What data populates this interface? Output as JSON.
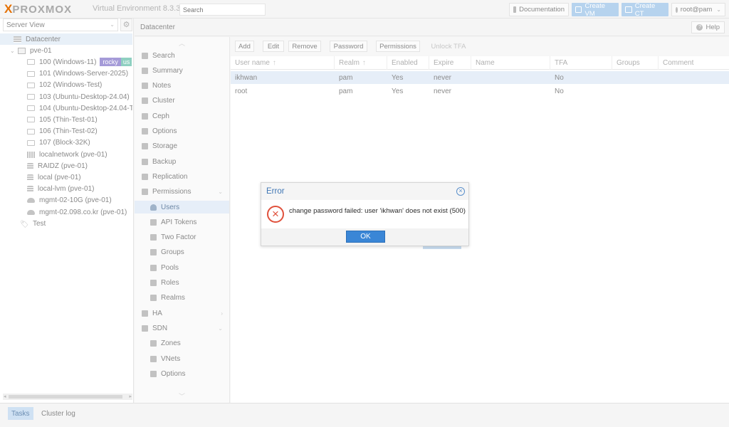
{
  "header": {
    "logo_mark": "X",
    "logo_word": "PROXMOX",
    "version": "Virtual Environment 8.3.3",
    "search_placeholder": "Search",
    "documentation": "Documentation",
    "create_vm": "Create VM",
    "create_ct": "Create CT",
    "user": "root@pam"
  },
  "tree": {
    "view": "Server View",
    "items": [
      {
        "label": "Datacenter",
        "icon": "datacenter-icon"
      },
      {
        "label": "pve-01",
        "icon": "node-icon"
      },
      {
        "label": "100 (Windows-11)",
        "icon": "vm-icon",
        "tags": [
          "rocky",
          "us"
        ]
      },
      {
        "label": "101 (Windows-Server-2025)",
        "icon": "vm-icon"
      },
      {
        "label": "102 (Windows-Test)",
        "icon": "vm-icon"
      },
      {
        "label": "103 (Ubuntu-Desktop-24.04)",
        "icon": "vm-icon"
      },
      {
        "label": "104 (Ubuntu-Desktop-24.04-TF",
        "icon": "vm-icon"
      },
      {
        "label": "105 (Thin-Test-01)",
        "icon": "vm-icon"
      },
      {
        "label": "106 (Thin-Test-02)",
        "icon": "vm-icon"
      },
      {
        "label": "107 (Block-32K)",
        "icon": "vm-icon"
      },
      {
        "label": "localnetwork (pve-01)",
        "icon": "network-icon"
      },
      {
        "label": "RAIDZ (pve-01)",
        "icon": "storage-icon"
      },
      {
        "label": "local (pve-01)",
        "icon": "storage-icon"
      },
      {
        "label": "local-lvm (pve-01)",
        "icon": "storage-icon"
      },
      {
        "label": "mgmt-02-10G (pve-01)",
        "icon": "cloud-storage-icon"
      },
      {
        "label": "mgmt-02.098.co.kr (pve-01)",
        "icon": "cloud-storage-icon"
      },
      {
        "label": "Test",
        "icon": "tag-icon"
      }
    ]
  },
  "breadcrumb": "Datacenter",
  "help": "Help",
  "menu": [
    {
      "label": "Search",
      "icon": "search-icon",
      "sub": false
    },
    {
      "label": "Summary",
      "icon": "summary-icon",
      "sub": false
    },
    {
      "label": "Notes",
      "icon": "notes-icon",
      "sub": false
    },
    {
      "label": "Cluster",
      "icon": "cluster-icon",
      "sub": false
    },
    {
      "label": "Ceph",
      "icon": "ceph-icon",
      "sub": false
    },
    {
      "label": "Options",
      "icon": "gear-icon",
      "sub": false
    },
    {
      "label": "Storage",
      "icon": "storage-icon",
      "sub": false
    },
    {
      "label": "Backup",
      "icon": "backup-icon",
      "sub": false
    },
    {
      "label": "Replication",
      "icon": "replication-icon",
      "sub": false
    },
    {
      "label": "Permissions",
      "icon": "key-icon",
      "sub": false,
      "expand": true
    },
    {
      "label": "Users",
      "icon": "user-icon",
      "sub": true,
      "selected": true
    },
    {
      "label": "API Tokens",
      "icon": "token-icon",
      "sub": true
    },
    {
      "label": "Two Factor",
      "icon": "two-factor-icon",
      "sub": true
    },
    {
      "label": "Groups",
      "icon": "groups-icon",
      "sub": true
    },
    {
      "label": "Pools",
      "icon": "pools-icon",
      "sub": true
    },
    {
      "label": "Roles",
      "icon": "roles-icon",
      "sub": true
    },
    {
      "label": "Realms",
      "icon": "realms-icon",
      "sub": true
    },
    {
      "label": "HA",
      "icon": "ha-icon",
      "sub": false,
      "expand": true
    },
    {
      "label": "SDN",
      "icon": "sdn-icon",
      "sub": false,
      "expand": true
    },
    {
      "label": "Zones",
      "icon": "zones-icon",
      "sub": true
    },
    {
      "label": "VNets",
      "icon": "vnets-icon",
      "sub": true
    },
    {
      "label": "Options",
      "icon": "gear-icon",
      "sub": true
    }
  ],
  "toolbar": {
    "add": "Add",
    "edit": "Edit",
    "remove": "Remove",
    "password": "Password",
    "permissions": "Permissions",
    "unlock_tfa": "Unlock TFA"
  },
  "grid": {
    "columns": [
      "User name",
      "Realm",
      "Enabled",
      "Expire",
      "Name",
      "TFA",
      "Groups",
      "Comment"
    ],
    "rows": [
      {
        "user": "ikhwan",
        "realm": "pam",
        "enabled": "Yes",
        "expire": "never",
        "name": "",
        "tfa": "No",
        "groups": "",
        "comment": ""
      },
      {
        "user": "root",
        "realm": "pam",
        "enabled": "Yes",
        "expire": "never",
        "name": "",
        "tfa": "No",
        "groups": "",
        "comment": ""
      }
    ]
  },
  "dialog": {
    "title": "Error",
    "message": "change password failed: user 'ikhwan' does not exist (500)",
    "ok": "OK"
  },
  "bottom": {
    "tasks": "Tasks",
    "cluster_log": "Cluster log"
  },
  "colors": {
    "accent": "#3a86d6",
    "error": "#e0513c",
    "brand": "#e57000"
  }
}
